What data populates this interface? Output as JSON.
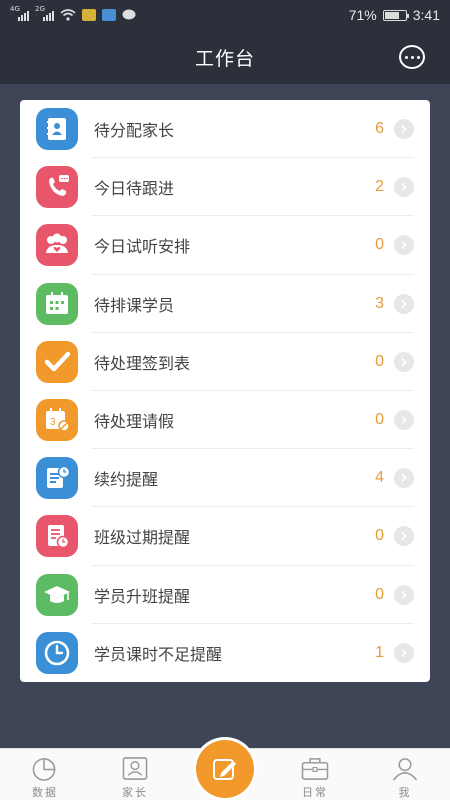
{
  "status_bar": {
    "sim1": "4G",
    "sim2": "2G",
    "battery_percent": "71%",
    "battery_level": 0.71,
    "time": "3:41"
  },
  "header": {
    "title": "工作台",
    "more_icon": "more-dots-icon"
  },
  "items": [
    {
      "label": "待分配家长",
      "count": "6",
      "icon": "parent-book-icon",
      "color": "#3a8fd6"
    },
    {
      "label": "今日待跟进",
      "count": "2",
      "icon": "phone-call-icon",
      "color": "#e8566b"
    },
    {
      "label": "今日试听安排",
      "count": "0",
      "icon": "people-heart-icon",
      "color": "#e8566b"
    },
    {
      "label": "待排课学员",
      "count": "3",
      "icon": "calendar-icon",
      "color": "#5dbb63"
    },
    {
      "label": "待处理签到表",
      "count": "0",
      "icon": "checkmark-icon",
      "color": "#f19a2b"
    },
    {
      "label": "待处理请假",
      "count": "0",
      "icon": "calendar-cancel-icon",
      "color": "#f19a2b"
    },
    {
      "label": "续约提醒",
      "count": "4",
      "icon": "document-clock-icon",
      "color": "#3a8fd6"
    },
    {
      "label": "班级过期提醒",
      "count": "0",
      "icon": "notebook-clock-icon",
      "color": "#e8566b"
    },
    {
      "label": "学员升班提醒",
      "count": "0",
      "icon": "graduation-cap-icon",
      "color": "#5dbb63"
    },
    {
      "label": "学员课时不足提醒",
      "count": "1",
      "icon": "clock-icon",
      "color": "#3a8fd6"
    }
  ],
  "bottom_nav": [
    {
      "label": "数据",
      "icon": "pie-chart-icon"
    },
    {
      "label": "家长",
      "icon": "contacts-icon"
    },
    {
      "label": "",
      "icon": "edit-icon"
    },
    {
      "label": "日常",
      "icon": "briefcase-icon"
    },
    {
      "label": "我",
      "icon": "person-icon"
    }
  ]
}
